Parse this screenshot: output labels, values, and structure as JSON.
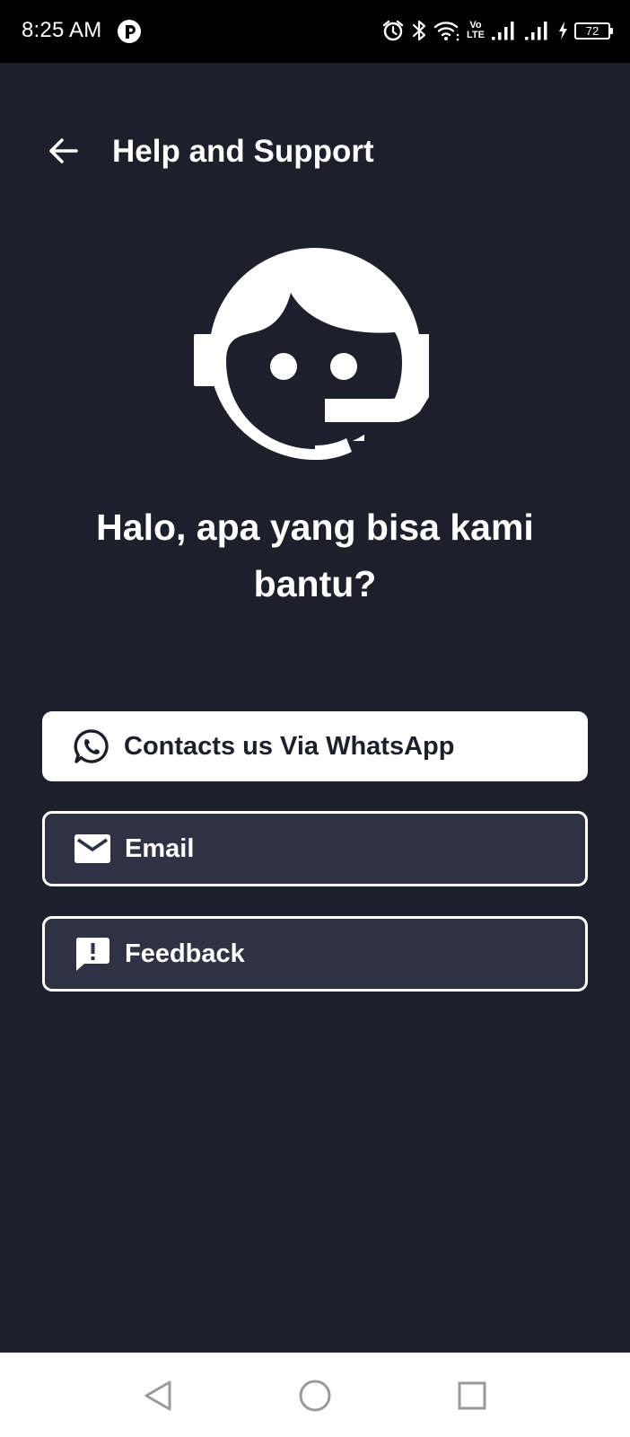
{
  "status_bar": {
    "time": "8:25 AM",
    "network_label_top": "Vo",
    "network_label_bottom": "LTE",
    "battery_level": "72",
    "icons": [
      "app-notification-icon",
      "alarm-icon",
      "bluetooth-icon",
      "wifi-icon",
      "volte-icon",
      "signal-icon",
      "signal-icon",
      "charging-icon",
      "battery-icon"
    ]
  },
  "app_bar": {
    "title": "Help and Support",
    "back_icon": "arrow-left-icon"
  },
  "illustration": {
    "icon": "support-agent-icon"
  },
  "greeting": "Halo, apa yang bisa kami bantu?",
  "actions": [
    {
      "label": "Contacts us Via WhatsApp",
      "icon": "whatsapp-icon"
    },
    {
      "label": "Email",
      "icon": "email-icon"
    },
    {
      "label": "Feedback",
      "icon": "feedback-icon"
    }
  ],
  "nav_bar": {
    "icons": [
      "nav-back-icon",
      "nav-home-icon",
      "nav-recents-icon"
    ]
  },
  "colors": {
    "background": "#1d1f2b",
    "status_bar": "#000000",
    "button_outline_fill": "#2f3242",
    "primary_button": "#ffffff",
    "text": "#ffffff"
  }
}
